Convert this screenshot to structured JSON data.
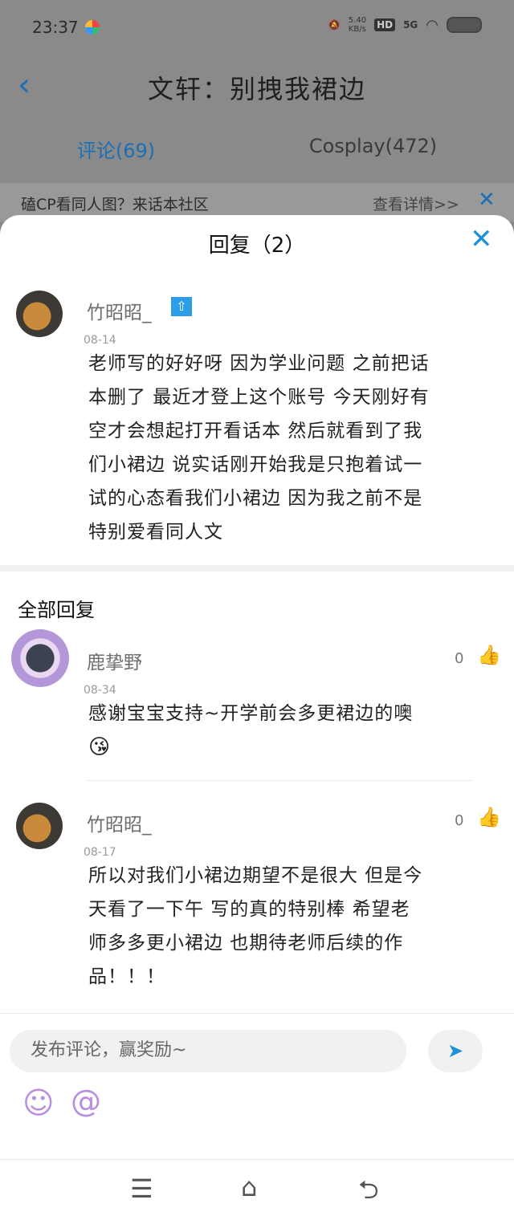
{
  "status_bar": {
    "time": "23:37",
    "net_speed_top": "5.40",
    "net_speed_unit": "KB/s",
    "hd": "HD",
    "signal": "5G"
  },
  "header": {
    "back_icon": "chevron-left-icon",
    "title": "文轩：别拽我裙边",
    "tabs": [
      {
        "label": "评论(69)",
        "active": true
      },
      {
        "label": "Cosplay(472)",
        "active": false
      }
    ]
  },
  "banner": {
    "text": "磕CP看同人图？来话本社区",
    "link": "查看详情>>",
    "close_icon": "close-icon"
  },
  "sheet": {
    "title": "回复（2）",
    "close_icon": "close-icon",
    "main_comment": {
      "username": "竹昭昭_",
      "badge": "⇧",
      "date": "08-14",
      "lines": [
        "老师写的好好呀 因为学业问题 之前把话",
        "本删了 最近才登上这个账号 今天刚好有",
        "空才会想起打开看话本 然后就看到了我",
        "们小裙边 说实话刚开始我是只抱着试一",
        "试的心态看我们小裙边 因为我之前不是",
        "特别爱看同人文"
      ]
    },
    "section_title": "全部回复",
    "replies": [
      {
        "username": "鹿挚野",
        "date": "08-34",
        "likes": "0",
        "lines": [
          "感谢宝宝支持~开学前会多更裙边的噢"
        ],
        "emoji": "😘"
      },
      {
        "username": "竹昭昭_",
        "date": "08-17",
        "likes": "0",
        "lines": [
          "所以对我们小裙边期望不是很大 但是今",
          "天看了一下午 写的真的特别棒 希望老",
          "师多多更小裙边 也期待老师后续的作",
          "品！！！"
        ]
      }
    ]
  },
  "composer": {
    "placeholder": "发布评论，赢奖励~",
    "send_icon": "send-icon",
    "emoji_icon": "smile-icon",
    "mention_icon": "at-icon"
  },
  "nav": {
    "menu_icon": "menu-icon",
    "home_icon": "home-icon",
    "back_icon": "back-icon"
  },
  "colors": {
    "accent": "#1e8fd8",
    "header_accent": "#1a6fb8",
    "icon_purple": "#b88fe0"
  }
}
